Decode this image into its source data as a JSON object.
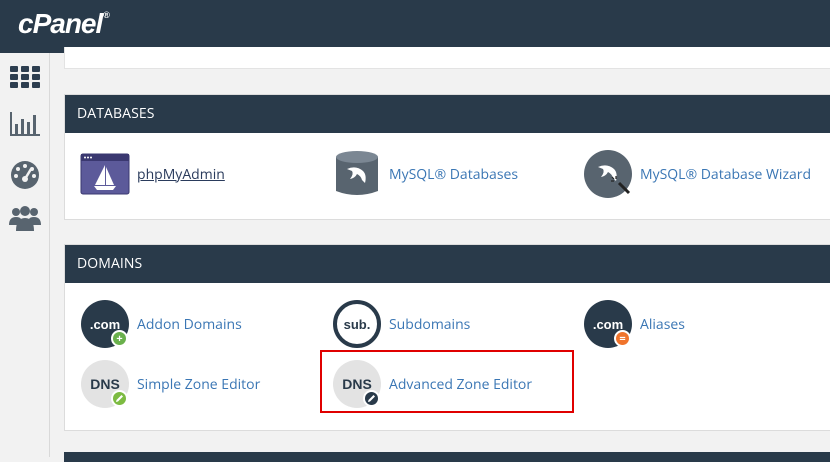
{
  "brand": {
    "logo_text": "cPanel",
    "reg_mark": "®"
  },
  "sidebar": {
    "items": [
      {
        "name": "apps-grid-icon"
      },
      {
        "name": "stats-chart-icon"
      },
      {
        "name": "dashboard-gauge-icon"
      },
      {
        "name": "users-icon"
      }
    ]
  },
  "databases": {
    "heading": "DATABASES",
    "items": [
      {
        "label": "phpMyAdmin",
        "icon": "phpmyadmin-icon"
      },
      {
        "label": "MySQL® Databases",
        "icon": "mysql-database-icon"
      },
      {
        "label": "MySQL® Database Wizard",
        "icon": "mysql-wizard-icon"
      }
    ]
  },
  "domains": {
    "heading": "DOMAINS",
    "items": [
      {
        "label": "Addon Domains",
        "icon_text": ".com",
        "badge": "+",
        "badge_color": "#6ab04c"
      },
      {
        "label": "Subdomains",
        "icon_text": "sub."
      },
      {
        "label": "Aliases",
        "icon_text": ".com",
        "badge": "=",
        "badge_color": "#f0742c"
      },
      {
        "label": "Simple Zone Editor",
        "icon_text": "DNS",
        "badge_color": "#7dbb42"
      },
      {
        "label": "Advanced Zone Editor",
        "icon_text": "DNS",
        "badge_color": "#293a4a"
      }
    ]
  },
  "colors": {
    "header_bg": "#293a4a",
    "link": "#3a76b4",
    "highlight": "#e00000"
  }
}
